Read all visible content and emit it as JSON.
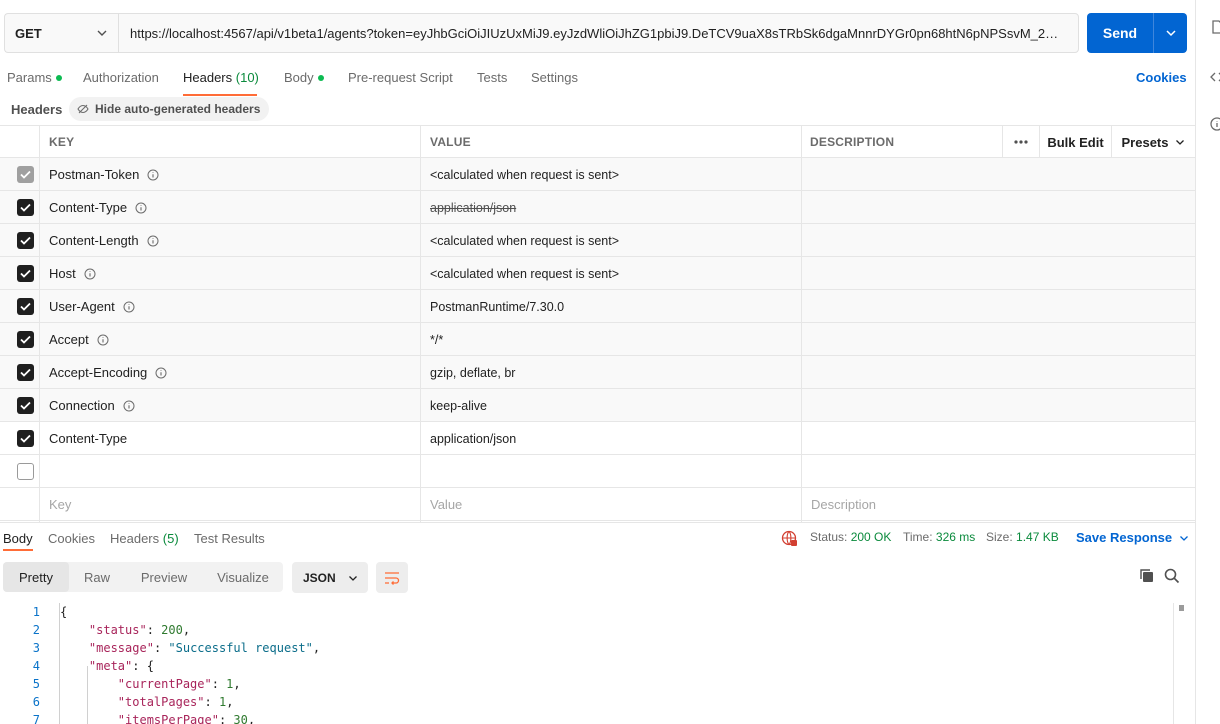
{
  "request": {
    "method": "GET",
    "url": "https://localhost:4567/api/v1beta1/agents?token=eyJhbGciOiJIUzUxMiJ9.eyJzdWliOiJhZG1pbiJ9.DeTCV9uaX8sTRbSk6dgaMnnrDYGr0pn68htN6pNPSsvM_2mn-KX...",
    "send_label": "Send"
  },
  "tabs": {
    "params": "Params",
    "authorization": "Authorization",
    "headers": "Headers",
    "headers_count": "(10)",
    "body": "Body",
    "prerequest": "Pre-request Script",
    "tests": "Tests",
    "settings": "Settings",
    "cookies": "Cookies"
  },
  "headers_section": {
    "title": "Headers",
    "hide_auto": "Hide auto-generated headers"
  },
  "table": {
    "col_key": "KEY",
    "col_value": "VALUE",
    "col_description": "DESCRIPTION",
    "bulk_edit": "Bulk Edit",
    "presets": "Presets",
    "rows": [
      {
        "key": "Postman-Token",
        "value": "<calculated when request is sent>",
        "checked": "dim"
      },
      {
        "key": "Content-Type",
        "value": "application/json",
        "checked": "on",
        "strike": true
      },
      {
        "key": "Content-Length",
        "value": "<calculated when request is sent>",
        "checked": "on"
      },
      {
        "key": "Host",
        "value": "<calculated when request is sent>",
        "checked": "on"
      },
      {
        "key": "User-Agent",
        "value": "PostmanRuntime/7.30.0",
        "checked": "on"
      },
      {
        "key": "Accept",
        "value": "*/*",
        "checked": "on"
      },
      {
        "key": "Accept-Encoding",
        "value": "gzip, deflate, br",
        "checked": "on"
      },
      {
        "key": "Connection",
        "value": "keep-alive",
        "checked": "on"
      },
      {
        "key": "Content-Type",
        "value": "application/json",
        "checked": "on"
      }
    ],
    "placeholder_key": "Key",
    "placeholder_value": "Value",
    "placeholder_description": "Description"
  },
  "response": {
    "tabs": {
      "body": "Body",
      "cookies": "Cookies",
      "headers": "Headers",
      "headers_count": "(5)",
      "test_results": "Test Results"
    },
    "status_label": "Status:",
    "status_value": "200 OK",
    "time_label": "Time:",
    "time_value": "326 ms",
    "size_label": "Size:",
    "size_value": "1.47 KB",
    "save_response": "Save Response",
    "views": [
      "Pretty",
      "Raw",
      "Preview",
      "Visualize"
    ],
    "format": "JSON",
    "code_lines": [
      {
        "n": "1",
        "text": "{"
      },
      {
        "n": "2",
        "text": "    \"status\": 200,"
      },
      {
        "n": "3",
        "text": "    \"message\": \"Successful request\","
      },
      {
        "n": "4",
        "text": "    \"meta\": {"
      },
      {
        "n": "5",
        "text": "        \"currentPage\": 1,"
      },
      {
        "n": "6",
        "text": "        \"totalPages\": 1,"
      },
      {
        "n": "7",
        "text": "        \"itemsPerPage\": 30,"
      }
    ]
  },
  "colors": {
    "accent": "#ff6c37",
    "primary": "#0265d2",
    "success": "#0a8a3c"
  }
}
